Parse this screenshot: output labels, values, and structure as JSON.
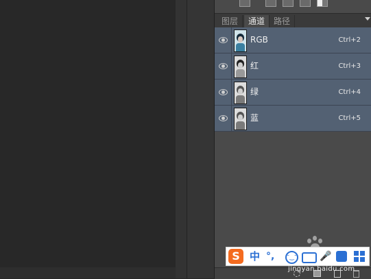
{
  "tabs": [
    {
      "label": "图层",
      "active": false
    },
    {
      "label": "通道",
      "active": true
    },
    {
      "label": "路径",
      "active": false
    }
  ],
  "channels": [
    {
      "name": "RGB",
      "shortcut": "Ctrl+2"
    },
    {
      "name": "红",
      "shortcut": "Ctrl+3"
    },
    {
      "name": "绿",
      "shortcut": "Ctrl+4"
    },
    {
      "name": "蓝",
      "shortcut": "Ctrl+5"
    }
  ],
  "ime": {
    "logo": "S",
    "language": "中",
    "punctuation": "°,",
    "tool": "🎤"
  },
  "watermark": "jingyan.baidu.com",
  "colors": {
    "selected_row": "#536173",
    "panel_bg": "#4a4a4a",
    "canvas_bg": "#282828",
    "ime_accent": "#2a6fd3",
    "ime_logo": "#f46b1f"
  },
  "icons": [
    "eye-icon",
    "panel-menu-icon",
    "load-selection-icon",
    "save-selection-mask-icon",
    "new-channel-icon",
    "delete-channel-icon",
    "emoji-icon",
    "keyboard-icon",
    "skin-icon",
    "toolbox-grid-icon",
    "baidu-paw-icon"
  ]
}
